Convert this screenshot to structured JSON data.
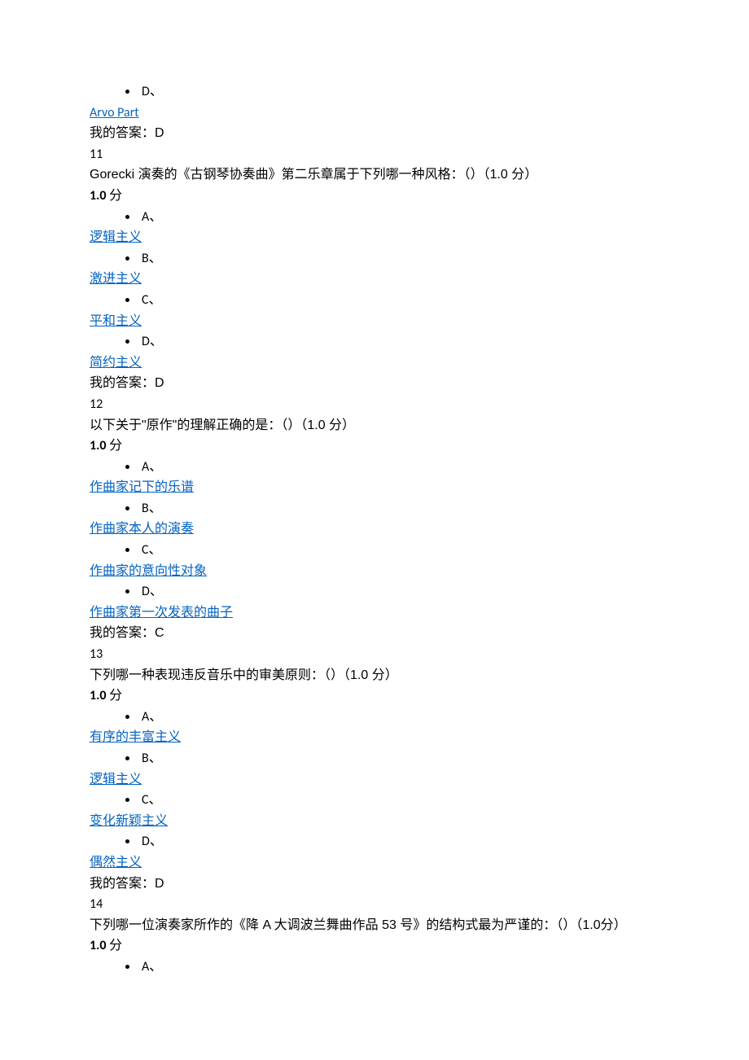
{
  "q10": {
    "optD_marker": "D、",
    "optD": "Arvo Part",
    "myanswer": "我的答案：D"
  },
  "q11": {
    "num": "11",
    "text": "Gorecki 演奏的《古钢琴协奏曲》第二乐章属于下列哪一种风格：（）（1.0 分）",
    "score": "1.0 ",
    "score_unit": "分",
    "A_marker": "A、",
    "A": "逻辑主义",
    "B_marker": "B、",
    "B": "激进主义",
    "C_marker": "C、",
    "C": "平和主义",
    "D_marker": "D、",
    "D": "简约主义",
    "myanswer": "我的答案：D"
  },
  "q12": {
    "num": "12",
    "text": "以下关于\"原作\"的理解正确的是：（）（1.0 分）",
    "score": "1.0 ",
    "score_unit": "分",
    "A_marker": "A、",
    "A": "作曲家记下的乐谱",
    "B_marker": "B、",
    "B": "作曲家本人的演奏",
    "C_marker": "C、",
    "C": "作曲家的意向性对象",
    "D_marker": "D、",
    "D": "作曲家第一次发表的曲子",
    "myanswer": "我的答案：C"
  },
  "q13": {
    "num": "13",
    "text": "下列哪一种表现违反音乐中的审美原则：（）（1.0 分）",
    "score": "1.0 ",
    "score_unit": "分",
    "A_marker": "A、",
    "A": "有序的丰富主义",
    "B_marker": "B、",
    "B": "逻辑主义",
    "C_marker": "C、",
    "C": "变化新颖主义",
    "D_marker": "D、",
    "D": "偶然主义",
    "myanswer": "我的答案：D"
  },
  "q14": {
    "num": "14",
    "text": "下列哪一位演奏家所作的《降 A 大调波兰舞曲作品 53 号》的结构式最为严谨的：（）（1.0分）",
    "score": "1.0 ",
    "score_unit": "分",
    "A_marker": "A、"
  }
}
